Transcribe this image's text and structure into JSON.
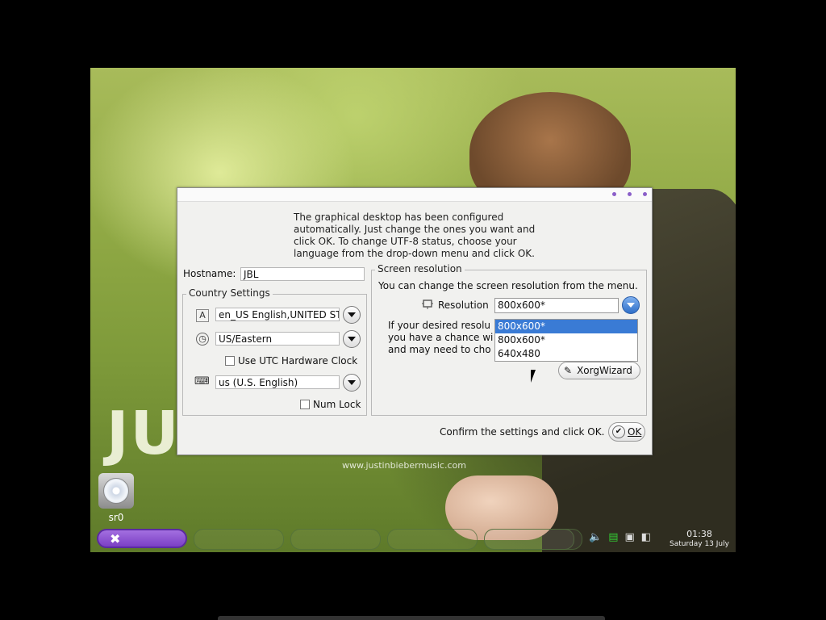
{
  "desktop": {
    "brand_text": "JUS",
    "brand_url": "www.justinbiebermusic.com",
    "icon_label": "sr0"
  },
  "taskbar": {
    "clock_time": "01:38",
    "clock_date": "Saturday 13 July"
  },
  "dialog": {
    "intro": "The graphical desktop has been configured automatically. Just change the ones you want and click OK. To change UTF-8 status, choose your language from the drop-down menu and click OK.",
    "hostname_label": "Hostname:",
    "hostname_value": "JBL",
    "country_legend": "Country Settings",
    "language_value": "en_US English,UNITED STA",
    "timezone_value": "US/Eastern",
    "utc_label": "Use UTC Hardware Clock",
    "keyboard_value": "us (U.S. English)",
    "numlock_label": "Num Lock",
    "screen_legend": "Screen resolution",
    "screen_desc": "You can change the screen resolution from the menu.",
    "resolution_label": "Resolution",
    "resolution_value": "800x600*",
    "help_line1": "If your desired resolu",
    "help_line2": "you have a chance wi",
    "help_line3": "and may need to cho",
    "resolution_options": [
      "800x600*",
      "800x600*",
      "640x480"
    ],
    "xorg_label": "XorgWizard",
    "confirm_text": "Confirm the settings and click OK.",
    "ok_label": "OK"
  }
}
